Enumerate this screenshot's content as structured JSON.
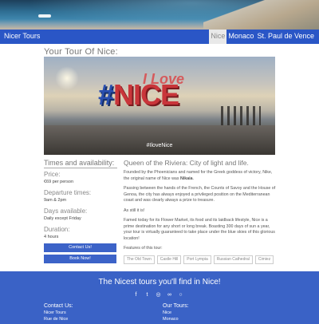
{
  "nav": {
    "brand": "Nicer Tours",
    "links": [
      {
        "label": "Nice",
        "active": true
      },
      {
        "label": "Monaco",
        "active": false
      },
      {
        "label": "St. Paul de Vence",
        "active": false
      }
    ]
  },
  "page": {
    "title": "Your Tour Of Nice:"
  },
  "photo": {
    "sign_hash": "#",
    "sign_love": "I Love",
    "sign_nice": "NICE",
    "caption": "#IloveNice"
  },
  "sidebar": {
    "heading": "Times and availability:",
    "price_label": "Price:",
    "price_value": "€69 per person",
    "departure_label": "Departure times:",
    "departure_value": "9am & 2pm",
    "days_label": "Days available:",
    "days_value": "Daily except Friday",
    "duration_label": "Duration:",
    "duration_value": "4 hours",
    "contact_button": "Contact Us!",
    "book_button": "Book Now!"
  },
  "main": {
    "heading": "Queen of the Riviera: City of light and life.",
    "para1_pre": "Founded by the Phoenicians and named for the Greek goddess of victory, Nike, the original name of Nice was ",
    "para1_bold": "Nikaia",
    "para1_post": ".",
    "para2": "Passing between the hands of the French, the Counts of Savoy and the House of Genoa, the city has always enjoyed a privileged position on the Mediterranean coast and was clearly always a prize to treasure.",
    "para3": "As still it is!",
    "para4": "Famed today for its Flower Market, its food and its laidback lifestyle, Nice is a prime destination for any short or long break. Boasting 300 days of sun a year, your tour is virtually guaranteed to take place under the blue skies of this glorious location!",
    "features_label": "Features of this tour:",
    "features": [
      "The Old Town",
      "Castle Hill",
      "Port Lympia",
      "Russian Cathedral",
      "Cimiez"
    ]
  },
  "footer": {
    "tagline": "The Nicest tours you'll find in Nice!",
    "socials": [
      {
        "icon": "facebook-icon",
        "glyph": "f"
      },
      {
        "icon": "twitter-icon",
        "glyph": "t"
      },
      {
        "icon": "instagram-icon",
        "glyph": "◎"
      },
      {
        "icon": "tripadvisor-icon",
        "glyph": "∞"
      },
      {
        "icon": "whatsapp-icon",
        "glyph": "○"
      }
    ],
    "contact_heading": "Contact Us:",
    "contact_items": [
      "Nicer Tours",
      "Rue de Nice"
    ],
    "tours_heading": "Our Tours:",
    "tours_items": [
      "Nice",
      "Monaco"
    ]
  },
  "colors": {
    "brand_blue": "#2a56c6",
    "button_blue": "#3c63c8",
    "footer_blue": "#3a62c6",
    "sign_blue": "#2a4fb0",
    "sign_red": "#c9353a"
  }
}
